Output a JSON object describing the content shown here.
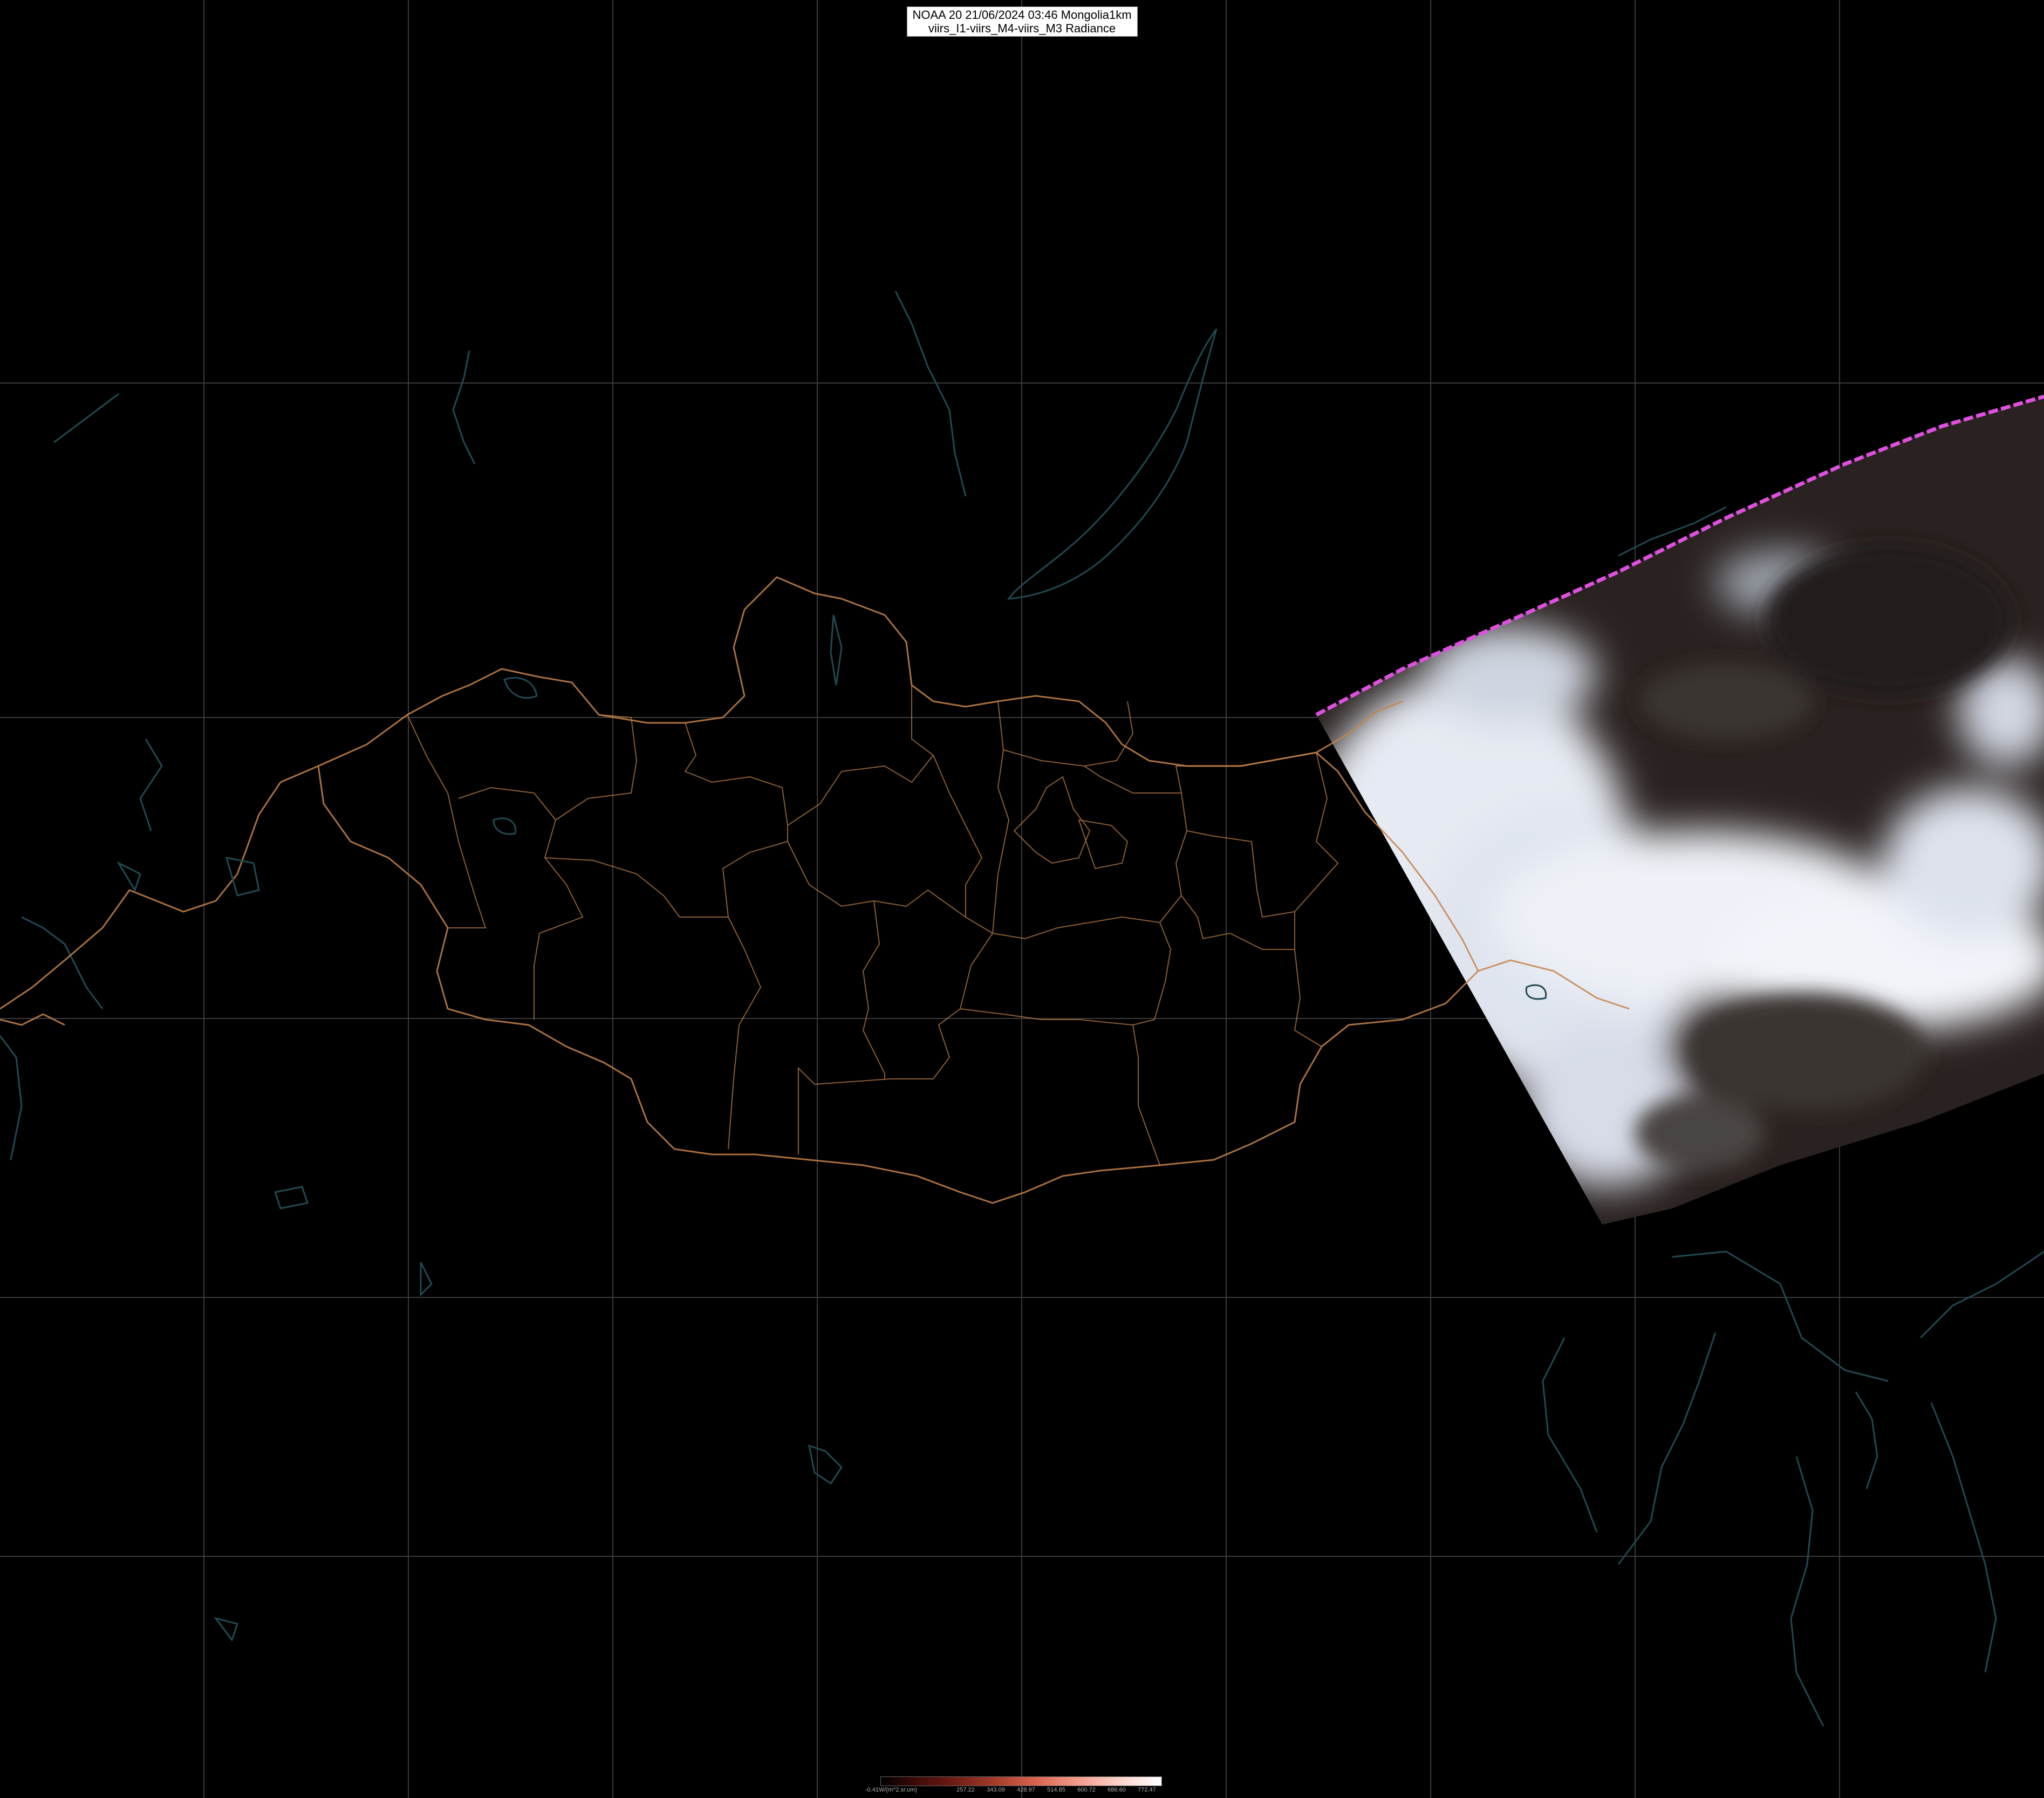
{
  "title": {
    "line1": "NOAA 20 21/06/2024 03:46 Mongolia1km",
    "line2": "viirs_I1-viirs_M4-viirs_M3 Radiance"
  },
  "colors": {
    "background": "#000000",
    "graticule": "#3a3a3a",
    "admin_borders": "#c7844a",
    "coastlines_lakes": "#1f4a52",
    "swath_edge": "#e050e0",
    "cloud": "#e8ecf4",
    "land_dark": "#2a2220"
  },
  "legend": {
    "unit_label": "-0.41W/(m^2.sr.um)",
    "ticks": [
      "257.22",
      "343.09",
      "428.97",
      "514.85",
      "600.72",
      "686.60",
      "772.47"
    ]
  },
  "layers": [
    "graticule",
    "country-borders",
    "province-borders",
    "lakes-rivers",
    "satellite-swath"
  ]
}
